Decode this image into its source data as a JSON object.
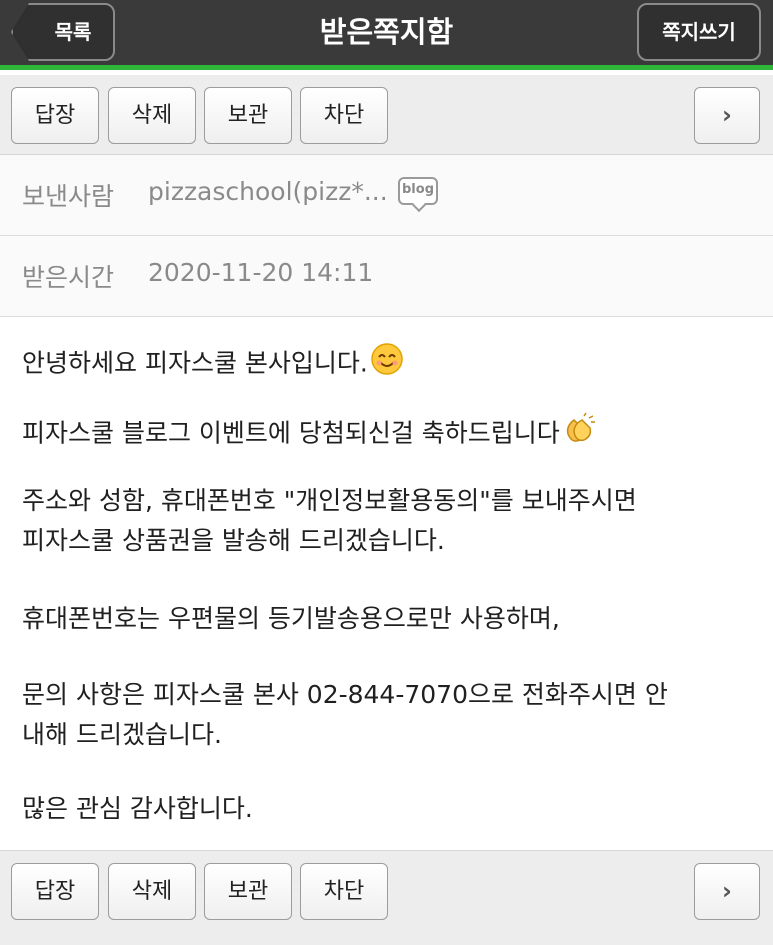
{
  "header": {
    "back_label": "목록",
    "title": "받은쪽지함",
    "write_label": "쪽지쓰기"
  },
  "toolbar": {
    "reply_label": "답장",
    "delete_label": "삭제",
    "save_label": "보관",
    "block_label": "차단",
    "next_label": "›"
  },
  "meta": {
    "sender_label": "보낸사람",
    "sender_value": "pizzaschool(pizz*...",
    "blog_badge": "blog",
    "time_label": "받은시간",
    "time_value": "2020-11-20 14:11"
  },
  "message": {
    "line1": "안녕하세요 피자스쿨 본사입니다.",
    "line2": "피자스쿨 블로그 이벤트에 당첨되신걸 축하드립니다",
    "line3a": "주소와 성함, 휴대폰번호 \"개인정보활용동의\"를 보내주시면",
    "line3b": "피자스쿨 상품권을 발송해 드리겠습니다.",
    "line4": "휴대폰번호는 우편물의 등기발송용으로만 사용하며,",
    "line5a": "문의 사항은 피자스쿨 본사 02-844-7070으로 전화주시면 안",
    "line5b": "내해 드리겠습니다.",
    "line6": "많은 관심 감사합니다."
  },
  "icons": {
    "smile": "smiling-face-emoji",
    "clap": "clapping-hands-emoji"
  },
  "colors": {
    "accent_green": "#2fb53a",
    "titlebar": "#3a3a3a"
  }
}
